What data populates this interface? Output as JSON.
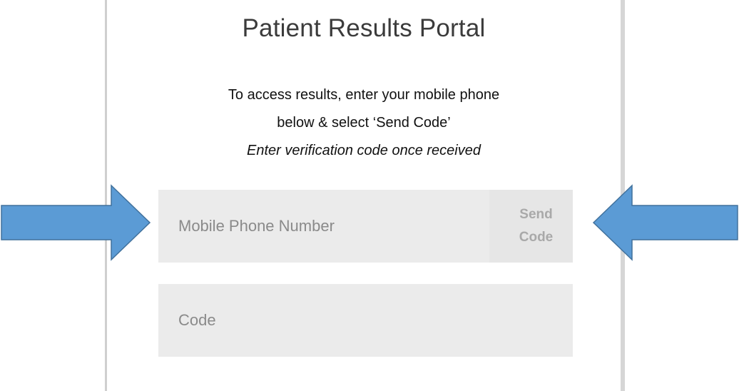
{
  "portal": {
    "title": "Patient Results Portal",
    "instruction_line1": "To access results, enter your mobile phone",
    "instruction_line2": "below & select ‘Send Code’",
    "instruction_line3": "Enter verification code once received"
  },
  "phone_field": {
    "placeholder": "Mobile Phone Number",
    "value": ""
  },
  "send_code_button": {
    "line1": "Send",
    "line2": "Code"
  },
  "code_field": {
    "placeholder": "Code",
    "value": ""
  },
  "colors": {
    "arrow_fill": "#5b9bd5",
    "arrow_stroke": "#41719c",
    "field_background": "#ebebeb",
    "button_text": "#a9a9a9"
  },
  "icons": {
    "left_arrow": "right-pointing-arrow",
    "right_arrow": "left-pointing-arrow"
  }
}
